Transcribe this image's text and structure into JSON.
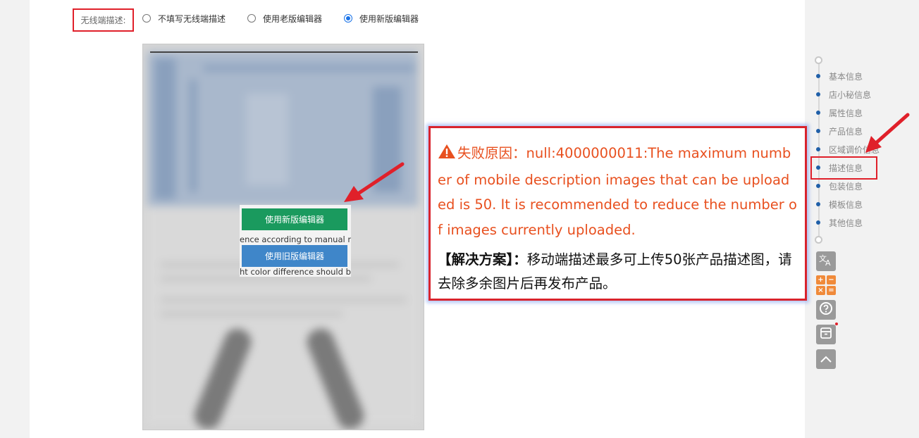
{
  "mobile_desc": {
    "label": "无线端描述:",
    "options": [
      "不填写无线端描述",
      "使用老版编辑器",
      "使用新版编辑器"
    ],
    "selected_index": 2
  },
  "preview": {
    "new_editor_button": "使用新版编辑器",
    "old_editor_button": "使用旧版编辑器",
    "snippet_line1": "ence according to manual m",
    "snippet_line2": "ht color difference should b"
  },
  "error": {
    "title": "失败原因：",
    "message": "null:4000000011:The maximum number of mobile description images that can be uploaded is 50. It is recommended to reduce the number of images currently uploaded.",
    "solution_label": "【解决方案】：",
    "solution_text": "移动端描述最多可上传50张产品描述图，请去除多余图片后再发布产品。"
  },
  "side_nav": {
    "items": [
      "基本信息",
      "店小秘信息",
      "属性信息",
      "产品信息",
      "区域调价信息",
      "描述信息",
      "包装信息",
      "模板信息",
      "其他信息"
    ],
    "active_index": 5
  },
  "tools": {
    "icons": [
      "translate-icon",
      "calculator-icon",
      "help-icon",
      "archive-icon",
      "back-to-top-icon"
    ],
    "accent_red": "#e0202a",
    "nav_dot_color": "#1f5fa8"
  },
  "calculator_symbols": [
    "+",
    "−",
    "×",
    "="
  ]
}
